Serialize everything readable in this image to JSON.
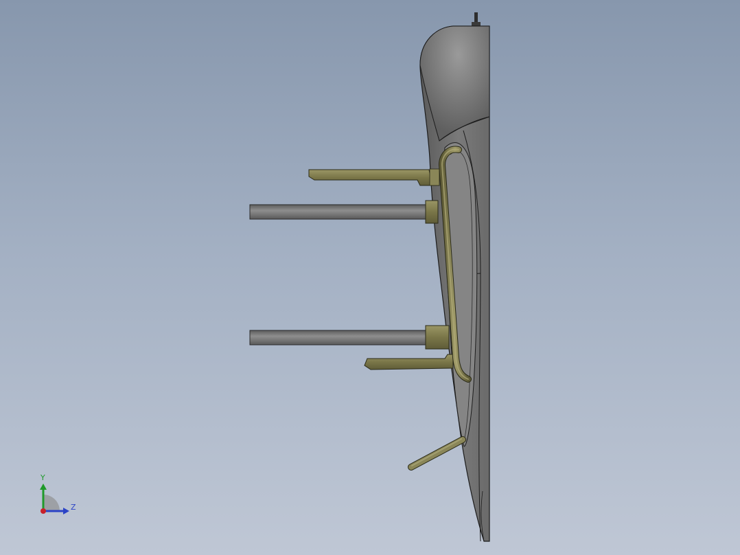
{
  "viewport": {
    "background_top": "#8797ad",
    "background_bottom": "#bfc7d5"
  },
  "model": {
    "body_color": "#6f6f6f",
    "fitting_color": "#7d7a4c",
    "rod_color": "#7c7c7c"
  },
  "triad": {
    "y_label": "Y",
    "z_label": "Z",
    "y_color": "#1f9a2a",
    "z_color": "#2b43c6",
    "origin_color": "#c8202a"
  }
}
